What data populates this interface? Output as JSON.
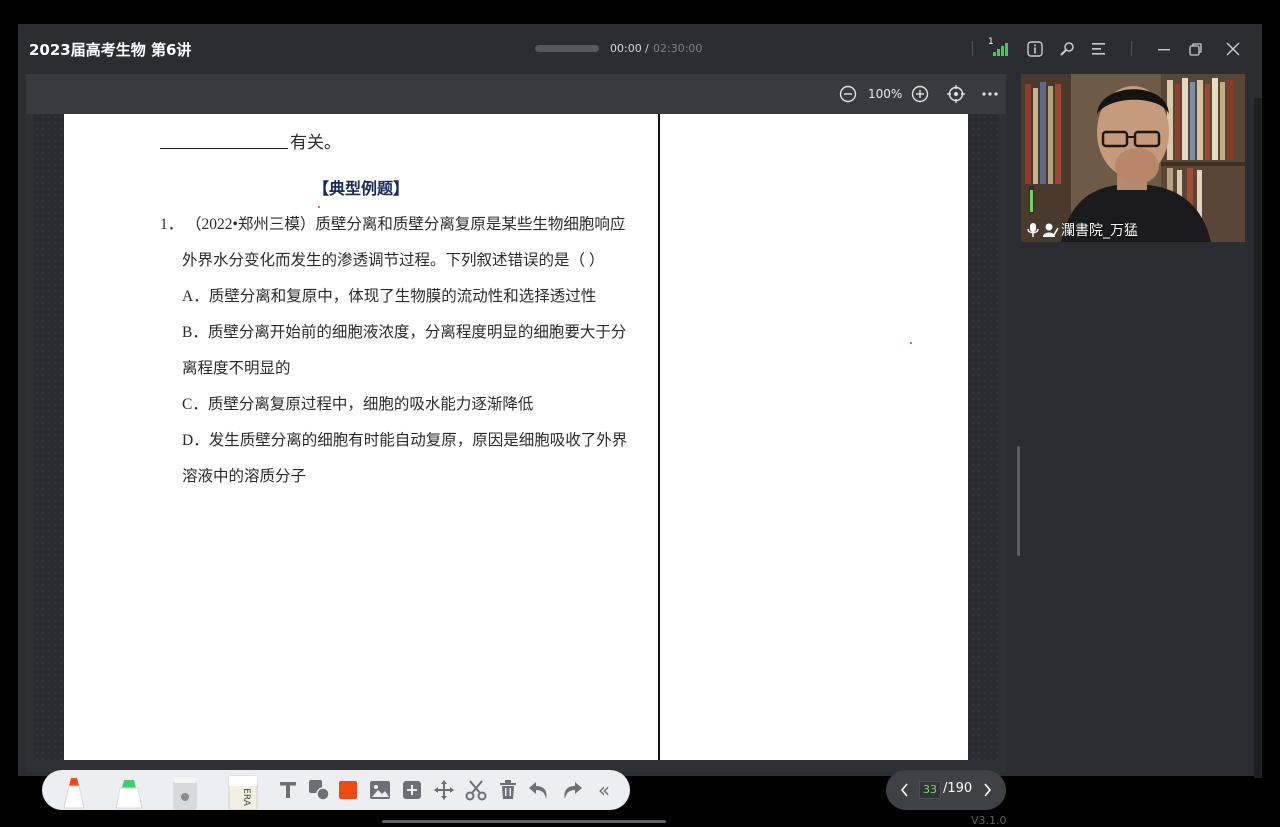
{
  "window": {
    "title": "2023届高考生物  第6讲",
    "time_current": "00:00",
    "time_separator": "/",
    "time_total": "02:30:00",
    "signal_count": "1"
  },
  "icons": {
    "signal": "signal-strength-icon",
    "info": "info-icon",
    "settings": "wrench-icon",
    "menu": "menu-lines-icon",
    "minimize": "minimize-icon",
    "restore": "restore-window-icon",
    "close": "close-icon"
  },
  "stage_toolbar": {
    "zoom": "100%"
  },
  "document": {
    "prev_line_suffix": "有关。",
    "section_heading": "【典型例题】",
    "question": {
      "number": "1．",
      "line1": "（2022•郑州三模）质壁分离和质壁分离复原是某些生物细胞响应",
      "line2": "外界水分变化而发生的渗透调节过程。下列叙述错误的是（        ）",
      "options": [
        {
          "text": "A．质壁分离和复原中，体现了生物膜的流动性和选择透过性"
        },
        {
          "text": "B．质壁分离开始前的细胞液浓度，分离程度明显的细胞要大于分",
          "cont": "离程度不明显的"
        },
        {
          "text": "C．质壁分离复原过程中，细胞的吸水能力逐渐降低"
        },
        {
          "text": "D．发生质壁分离的细胞有时能自动复原，原因是细胞吸收了外界",
          "cont": "溶液中的溶质分子"
        }
      ]
    }
  },
  "bottom_toolbar": {
    "tools": [
      "pen-red",
      "highlighter-green",
      "shape-stamp",
      "eraser",
      "text",
      "shape",
      "color",
      "image",
      "add-page",
      "move",
      "cut",
      "delete",
      "undo",
      "redo",
      "collapse"
    ],
    "eraser_label": "ERA",
    "collapse_label": "«",
    "accent_color": "#f04a12"
  },
  "pager": {
    "current": "33",
    "total": "/190"
  },
  "video": {
    "participant_name": "瀾書院_万猛"
  },
  "version": "V3.1.0"
}
